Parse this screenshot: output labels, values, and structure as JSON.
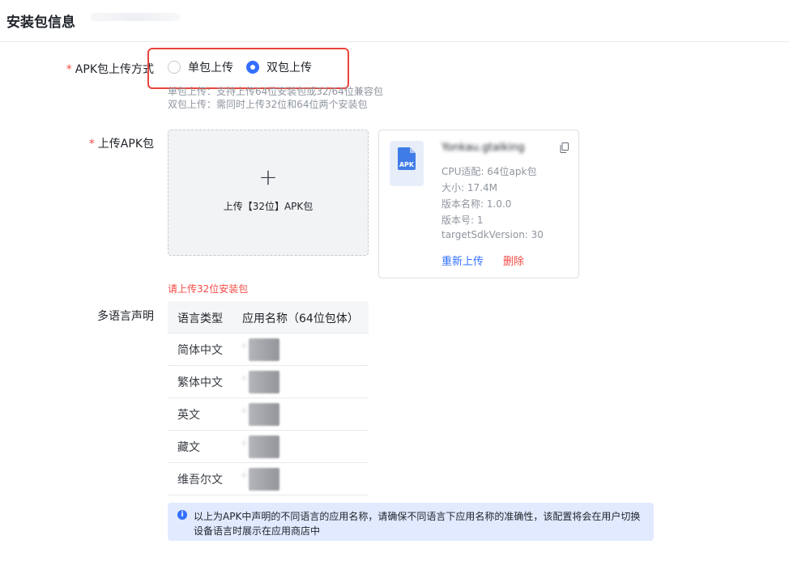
{
  "header": {
    "title": "安装包信息"
  },
  "upload_mode": {
    "label": "APK包上传方式",
    "required_mark": "*",
    "options": [
      {
        "label": "单包上传",
        "checked": false
      },
      {
        "label": "双包上传",
        "checked": true
      }
    ],
    "help": [
      "单包上传：支持上传64位安装包或32/64位兼容包",
      "双包上传：需同时上传32位和64位两个安装包"
    ]
  },
  "upload_apk": {
    "label": "上传APK包",
    "required_mark": "*",
    "upload_box_plus": "+",
    "upload_box_text": "上传【32位】APK包",
    "error": "请上传32位安装包",
    "file_card": {
      "icon_label": "APK",
      "file_name": "Yonkau.gtalking",
      "meta": [
        "CPU适配: 64位apk包",
        "大小: 17.4M",
        "版本名称: 1.0.0",
        "版本号: 1",
        "targetSdkVersion: 30"
      ],
      "reupload_label": "重新上传",
      "delete_label": "删除"
    }
  },
  "languages": {
    "label": "多语言声明",
    "headers": [
      "语言类型",
      "应用名称（64位包体）"
    ],
    "rows": [
      {
        "type": "简体中文",
        "name": "·"
      },
      {
        "type": "繁体中文",
        "name": "·"
      },
      {
        "type": "英文",
        "name": "·"
      },
      {
        "type": "藏文",
        "name": "·"
      },
      {
        "type": "维吾尔文",
        "name": "·"
      }
    ]
  },
  "info_banner": {
    "icon": "i",
    "text": "以上为APK中声明的不同语言的应用名称，请确保不同语言下应用名称的准确性，该配置将会在用户切换设备语言时展示在应用商店中"
  },
  "colors": {
    "primary": "#3370ff",
    "danger": "#f54a45",
    "highlight_border": "#e8453c"
  }
}
